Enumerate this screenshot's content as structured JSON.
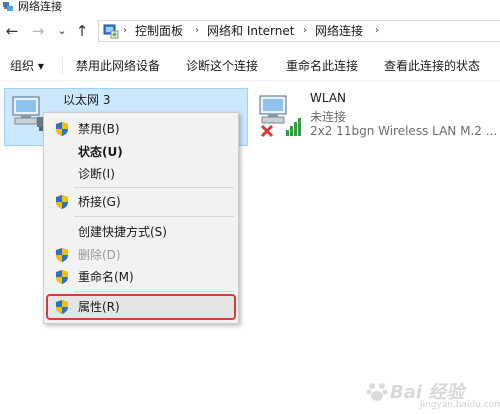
{
  "window": {
    "title": "网络连接",
    "icon": "network-connections-icon"
  },
  "nav": {
    "back": "←",
    "forward": "→",
    "recent": "⌄",
    "up": "↑"
  },
  "address": {
    "crumbs": [
      "控制面板",
      "网络和 Internet",
      "网络连接"
    ],
    "separator": "›"
  },
  "toolbar": {
    "organize": "组织 ▾",
    "items": [
      "禁用此网络设备",
      "诊断这个连接",
      "重命名此连接",
      "查看此连接的状态"
    ]
  },
  "connections": [
    {
      "name": "以太网 3",
      "selected": true
    },
    {
      "name": "WLAN",
      "status": "未连接",
      "adapter": "2x2 11bgn Wireless LAN M.2 ..."
    }
  ],
  "context_menu": {
    "items": [
      {
        "label": "禁用(B)",
        "icon": "shield-icon"
      },
      {
        "label": "状态(U)",
        "bold": true
      },
      {
        "label": "诊断(I)"
      },
      {
        "label": "桥接(G)",
        "icon": "shield-icon"
      },
      {
        "label": "创建快捷方式(S)"
      },
      {
        "label": "删除(D)",
        "icon": "shield-icon",
        "disabled": true
      },
      {
        "label": "重命名(M)",
        "icon": "shield-icon"
      },
      {
        "label": "属性(R)",
        "icon": "shield-icon",
        "highlighted": true
      }
    ]
  },
  "watermark": {
    "text": "Bai 经验",
    "sub": "jingyan.baidu.com"
  },
  "colors": {
    "selection": "#cce8ff",
    "highlight_border": "#d63c3c",
    "shield_blue": "#2f6fc4",
    "shield_yellow": "#f2c200"
  }
}
